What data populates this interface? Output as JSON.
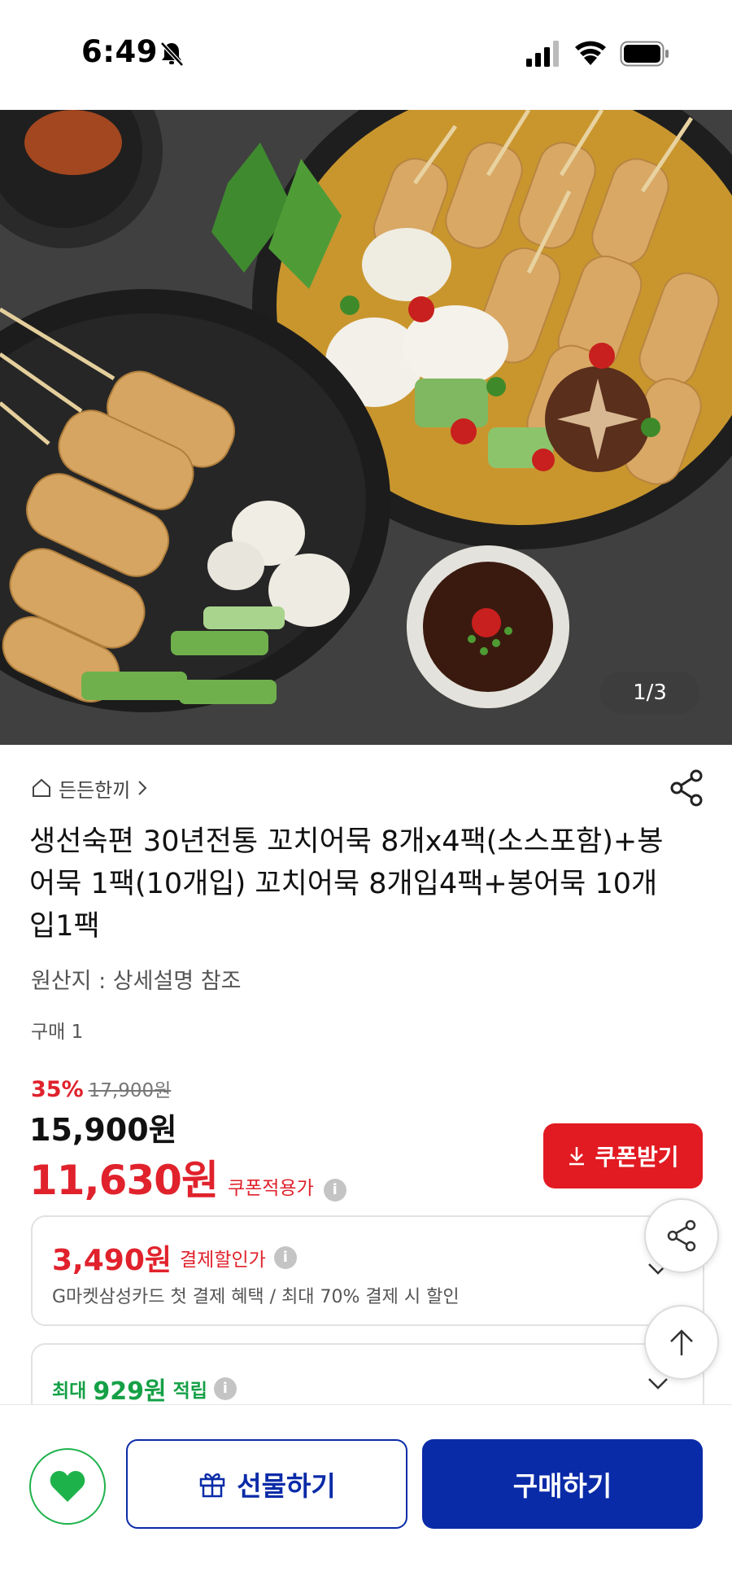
{
  "status_bar": {
    "time": "6:49"
  },
  "gallery": {
    "counter": "1/3"
  },
  "store": {
    "name": "든든한끼"
  },
  "product": {
    "title": "생선숙편 30년전통 꼬치어묵 8개x4팩(소스포함)+봉어묵 1팩(10개입) 꼬치어묵 8개입4팩+봉어묵 10개입1팩",
    "origin": "원산지 : 상세설명 참조",
    "purchase_count": "구매 1"
  },
  "pricing": {
    "discount_rate": "35%",
    "original_price": "17,900원",
    "sale_price": "15,900원",
    "coupon_price": "11,630원",
    "coupon_price_label": "쿠폰적용가"
  },
  "coupon_button": {
    "label": "쿠폰받기"
  },
  "payment_discount": {
    "amount": "3,490원",
    "label": "결제할인가",
    "description": "G마켓삼성카드 첫 결제 혜택 / 최대 70% 결제 시 할인"
  },
  "points": {
    "prefix": "최대",
    "amount": "929원",
    "suffix": "적립"
  },
  "bottom_bar": {
    "gift_label": "선물하기",
    "buy_label": "구매하기"
  },
  "colors": {
    "accent_red": "#e0222c",
    "brand_blue": "#0a2ba8",
    "point_green": "#14a046"
  },
  "icons": [
    "bell-slash-icon",
    "signal-icon",
    "wifi-icon",
    "battery-icon",
    "home-icon",
    "share-icon",
    "download-icon",
    "info-icon",
    "chevron-down-icon",
    "arrow-up-icon",
    "heart-icon",
    "gift-icon"
  ]
}
